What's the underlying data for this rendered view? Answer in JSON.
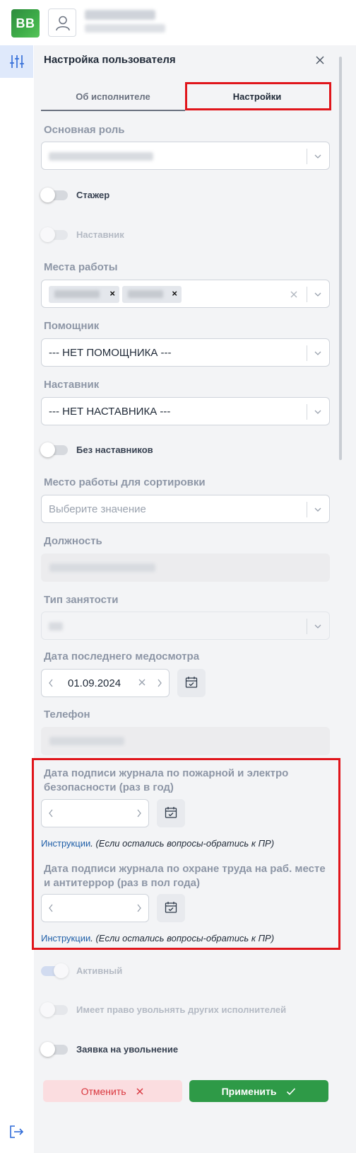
{
  "app": {
    "logo_text": "BB"
  },
  "panel": {
    "title": "Настройка пользователя"
  },
  "tabs": [
    {
      "label": "Об исполнителе"
    },
    {
      "label": "Настройки"
    }
  ],
  "form": {
    "main_role_label": "Основная роль",
    "trainee_label": "Стажер",
    "mentor_toggle_label": "Наставник",
    "workplaces_label": "Места работы",
    "assistant_label": "Помощник",
    "assistant_value": "--- НЕТ ПОМОЩНИКА ---",
    "mentor_label": "Наставник",
    "mentor_value": "--- НЕТ НАСТАВНИКА ---",
    "no_mentors_label": "Без наставников",
    "sort_workplace_label": "Место работы для сортировки",
    "sort_workplace_placeholder": "Выберите значение",
    "position_label": "Должность",
    "employment_label": "Тип занятости",
    "last_medical_label": "Дата последнего медосмотра",
    "last_medical_value": "01.09.2024",
    "phone_label": "Телефон",
    "fire_journal_label": "Дата подписи журнала по пожарной и электро безопасности (раз в год)",
    "labor_journal_label": "Дата подписи журнала по охране труда на раб. месте и антитеррор (раз в пол года)",
    "instructions_link": "Инструкции",
    "instructions_note": ". (Если остались вопросы-обратись к ПР)",
    "active_label": "Активный",
    "can_fire_label": "Имеет право увольнять других исполнителей",
    "dismissal_label": "Заявка на увольнение"
  },
  "footer": {
    "cancel_label": "Отменить",
    "apply_label": "Применить"
  },
  "colors": {
    "accent_green": "#2e9a47",
    "cancel_red": "#d9363e",
    "highlight_red": "#e0151b",
    "link_blue": "#1f5fa8"
  }
}
